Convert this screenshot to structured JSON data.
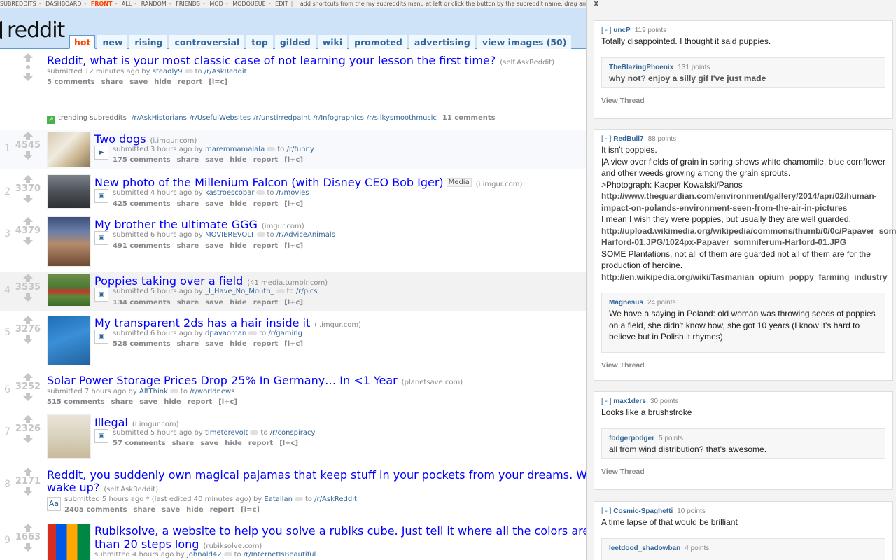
{
  "srbar": {
    "items": [
      "SUBREDDITS",
      "DASHBOARD",
      "FRONT",
      "ALL",
      "RANDOM",
      "FRIENDS",
      "MOD",
      "MODQUEUE",
      "EDIT"
    ],
    "hint": "add shortcuts from the my subreddits menu at left or click the button by the subreddit name, drag and"
  },
  "logo": "reddit",
  "tabs": [
    "hot",
    "new",
    "rising",
    "controversial",
    "top",
    "gilded",
    "wiki",
    "promoted",
    "advertising",
    "view images (50)"
  ],
  "sticky": {
    "title": "Reddit, what is your most classic case of not learning your lesson the first time?",
    "domain": "(self.AskReddit)",
    "submitted": "submitted 12 minutes ago by",
    "author": "steadly9",
    "to": "to",
    "sub": "/r/AskReddit",
    "actions": [
      "5 comments",
      "share",
      "save",
      "hide",
      "report",
      "[l=c]"
    ]
  },
  "trending": {
    "label": "trending subreddits",
    "subs": [
      "/r/AskHistorians",
      "/r/UsefulWebsites",
      "/r/unstirredpaint",
      "/r/Infographics",
      "/r/silkysmoothmusic"
    ],
    "comments": "11 comments"
  },
  "posts": [
    {
      "rank": "1",
      "score": "4545",
      "title": "Two dogs",
      "domain": "(i.imgur.com)",
      "submitted": "submitted 3 hours ago by",
      "author": "maremmamalala",
      "to": "to",
      "sub": "/r/funny",
      "actions": [
        "175 comments",
        "share",
        "save",
        "hide",
        "report",
        "[l+c]"
      ]
    },
    {
      "rank": "2",
      "score": "3370",
      "title": "New photo of the Millenium Falcon (with Disney CEO Bob Iger)",
      "flair": "Media",
      "domain": "(i.imgur.com)",
      "submitted": "submitted 4 hours ago by",
      "author": "kastroescobar",
      "to": "to",
      "sub": "/r/movies",
      "actions": [
        "425 comments",
        "share",
        "save",
        "hide",
        "report",
        "[l+c]"
      ]
    },
    {
      "rank": "3",
      "score": "4379",
      "title": "My brother the ultimate GGG",
      "domain": "(imgur.com)",
      "submitted": "submitted 6 hours ago by",
      "author": "MOVIEREVOLT",
      "to": "to",
      "sub": "/r/AdviceAnimals",
      "actions": [
        "491 comments",
        "share",
        "save",
        "hide",
        "report",
        "[l+c]"
      ]
    },
    {
      "rank": "4",
      "score": "3535",
      "title": "Poppies taking over a field",
      "domain": "(41.media.tumblr.com)",
      "submitted": "submitted 5 hours ago by",
      "author": "_I_Have_No_Mouth_",
      "to": "to",
      "sub": "/r/pics",
      "actions": [
        "134 comments",
        "share",
        "save",
        "hide",
        "report",
        "[l+c]"
      ]
    },
    {
      "rank": "5",
      "score": "3276",
      "title": "My transparent 2ds has a hair inside it",
      "domain": "(i.imgur.com)",
      "submitted": "submitted 6 hours ago by",
      "author": "dpavaoman",
      "to": "to",
      "sub": "/r/gaming",
      "actions": [
        "528 comments",
        "share",
        "save",
        "hide",
        "report",
        "[l+c]"
      ]
    },
    {
      "rank": "6",
      "score": "3252",
      "title": "Solar Power Storage Prices Drop 25% In Germany… In <1 Year",
      "domain": "(planetsave.com)",
      "submitted": "submitted 7 hours ago by",
      "author": "AltThink",
      "to": "to",
      "sub": "/r/worldnews",
      "actions": [
        "515 comments",
        "share",
        "save",
        "hide",
        "report",
        "[l+c]"
      ]
    },
    {
      "rank": "7",
      "score": "2326",
      "title": "Illegal",
      "domain": "(i.imgur.com)",
      "submitted": "submitted 5 hours ago by",
      "author": "timetorevolt",
      "to": "to",
      "sub": "/r/conspiracy",
      "actions": [
        "57 comments",
        "share",
        "save",
        "hide",
        "report",
        "[l+c]"
      ]
    },
    {
      "rank": "8",
      "score": "2171",
      "title": "Reddit, you suddenly own magical pajamas that keep stuff in your pockets from your dreams. What woul",
      "title2": "wake up?",
      "domain": "(self.AskReddit)",
      "submitted": "submitted 5 hours ago * (last edited 40 minutes ago) by",
      "author": "Eatallan",
      "to": "to",
      "sub": "/r/AskReddit",
      "actions": [
        "2405 comments",
        "share",
        "save",
        "hide",
        "report",
        "[l=c]"
      ]
    },
    {
      "rank": "9",
      "score": "1663",
      "title": "Rubiksolve, a website to help you solve a rubiks cube. Just tell it where all the colors are, and it",
      "title2": "than 20 steps long",
      "domain": "(rubiksolve.com)",
      "submitted": "submitted 4 hours ago by",
      "author": "johnald42",
      "to": "to",
      "sub": "/r/InternetIsBeautiful",
      "actions": []
    }
  ],
  "panel": {
    "close": "X",
    "toggle": "[ - ]",
    "view_thread": "View Thread",
    "comments": [
      {
        "author": "uncP",
        "points": "119 points",
        "body": [
          "Totally disappointed. I thought it said puppies."
        ],
        "child": {
          "author": "TheBlazingPhoenix",
          "points": "131 points",
          "body": [
            "why not? enjoy a silly gif I've just made"
          ]
        }
      },
      {
        "author": "RedBull7",
        "points": "88 points",
        "body": [
          "It isn't poppies.",
          "|A view over fields of grain in spring shows white chamomile, blue cornflower",
          "and other weeds growing among the grain sprouts.",
          ">Photograph: Kacper Kowalski/Panos"
        ],
        "link1": [
          "http://www.theguardian.com/environment/gallery/2014/apr/02/human-",
          "impact-on-polands-environment-seen-from-the-air-in-pictures"
        ],
        "body2": [
          "I mean I wish they were poppies, but usually they are well guarded."
        ],
        "link2": [
          "http://upload.wikimedia.org/wikipedia/commons/thumb/0/0c/Papaver_somni",
          "Harford-01.JPG/1024px-Papaver_somniferum-Harford-01.JPG"
        ],
        "body3": [
          "SOME Plantations, not all of them are guarded not all of them are for the",
          "production of heroine."
        ],
        "link3": [
          "http://en.wikipedia.org/wiki/Tasmanian_opium_poppy_farming_industry"
        ],
        "child": {
          "author": "Magnesus",
          "points": "24 points",
          "body": [
            "We have a saying in Poland: old woman was throwing seeds of poppies",
            "on a field, she didn't know how, she got 10 years (I know it's hard to",
            "believe but in Polish it rhymes)."
          ]
        }
      },
      {
        "author": "max1ders",
        "points": "30 points",
        "body": [
          "Looks like a brushstroke"
        ],
        "child": {
          "author": "fodgerpodger",
          "points": "5 points",
          "body": [
            "all from wind distribution? that's awesome."
          ]
        }
      },
      {
        "author": "Cosmic-Spaghetti",
        "points": "10 points",
        "body": [
          "A time lapse of that would be brilliant"
        ],
        "child": {
          "author": "leetdood_shadowban",
          "points": "4 points",
          "body": []
        }
      }
    ]
  }
}
